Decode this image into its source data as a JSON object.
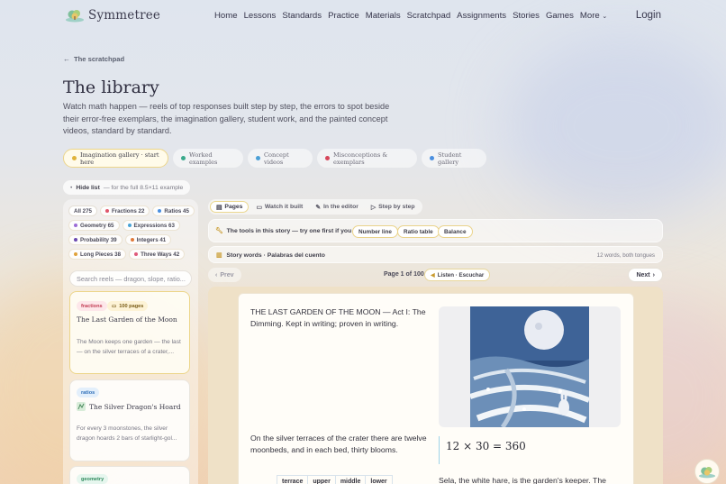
{
  "brand": {
    "name": "Symmetree"
  },
  "nav": {
    "links": [
      "Home",
      "Lessons",
      "Standards",
      "Practice",
      "Materials",
      "Scratchpad",
      "Assignments",
      "Stories",
      "Games"
    ],
    "more": "More",
    "login": "Login"
  },
  "breadcrumb": {
    "back": "The scratchpad"
  },
  "header": {
    "title": "The library",
    "lede": "Watch math happen — reels of top responses built step by step, the errors to spot beside their error-free exemplars, the imagination gallery, student work, and the painted concept videos, standard by standard."
  },
  "tabs": [
    {
      "label": "Imagination gallery · start here",
      "color": "#e0b33a",
      "active": true
    },
    {
      "label": "Worked examples",
      "color": "#3aa98b",
      "active": false
    },
    {
      "label": "Concept videos",
      "color": "#4a9fd6",
      "active": false
    },
    {
      "label": "Misconceptions & exemplars",
      "color": "#d6465a",
      "active": false
    },
    {
      "label": "Student gallery",
      "color": "#4a8fe0",
      "active": false
    }
  ],
  "hide_list": {
    "label": "Hide list",
    "hint": "— for the full 8.5×11 example"
  },
  "filters": [
    {
      "label": "All 275",
      "color": ""
    },
    {
      "label": "Fractions 22",
      "color": "#e0566a"
    },
    {
      "label": "Ratios 45",
      "color": "#4a8fe0"
    },
    {
      "label": "Geometry 65",
      "color": "#9b6bd6"
    },
    {
      "label": "Expressions 63",
      "color": "#4aa3d6"
    },
    {
      "label": "Probability 39",
      "color": "#6b4ab0"
    },
    {
      "label": "Integers 41",
      "color": "#e07a3a"
    },
    {
      "label": "Long Pieces 38",
      "color": "#e0a23a"
    },
    {
      "label": "Three Ways 42",
      "color": "#e05a7a"
    }
  ],
  "search": {
    "placeholder": "Search reels — dragon, slope, ratio..."
  },
  "cards": [
    {
      "tag": "fractions",
      "pages": "100 pages",
      "title": "The Last Garden of the Moon",
      "body": "The Moon keeps one garden — the last — on the silver terraces of a crater,..."
    },
    {
      "tag": "ratios",
      "title": "The Silver Dragon's Hoard",
      "body": "For every 3 moonstones, the silver dragon hoards 2 bars of starlight-gol..."
    },
    {
      "tag": "geometry"
    }
  ],
  "toolbar": [
    "Pages",
    "Watch it built",
    "In the editor",
    "Step by step"
  ],
  "tools": {
    "label": "The tools in this story — try one first if you like:",
    "items": [
      "Number line",
      "Ratio table",
      "Balance"
    ]
  },
  "story_words": {
    "label": "Story words · Palabras del cuento",
    "right": "12 words, both tongues"
  },
  "pager": {
    "prev": "Prev",
    "page": "Page 1 of 100",
    "listen": "Listen · Escuchar",
    "next": "Next"
  },
  "book": {
    "heading": "THE LAST GARDEN OF THE MOON — Act I: The Dimming. Kept in writing; proven in writing.",
    "para": "On the silver terraces of the crater there are twelve moonbeds, and in each bed, thirty blooms.",
    "equation": "12 × 30 = 360",
    "table_headers": [
      "terrace",
      "upper",
      "middle",
      "lower"
    ],
    "sela": "Sela, the white hare, is the garden's keeper. The"
  }
}
